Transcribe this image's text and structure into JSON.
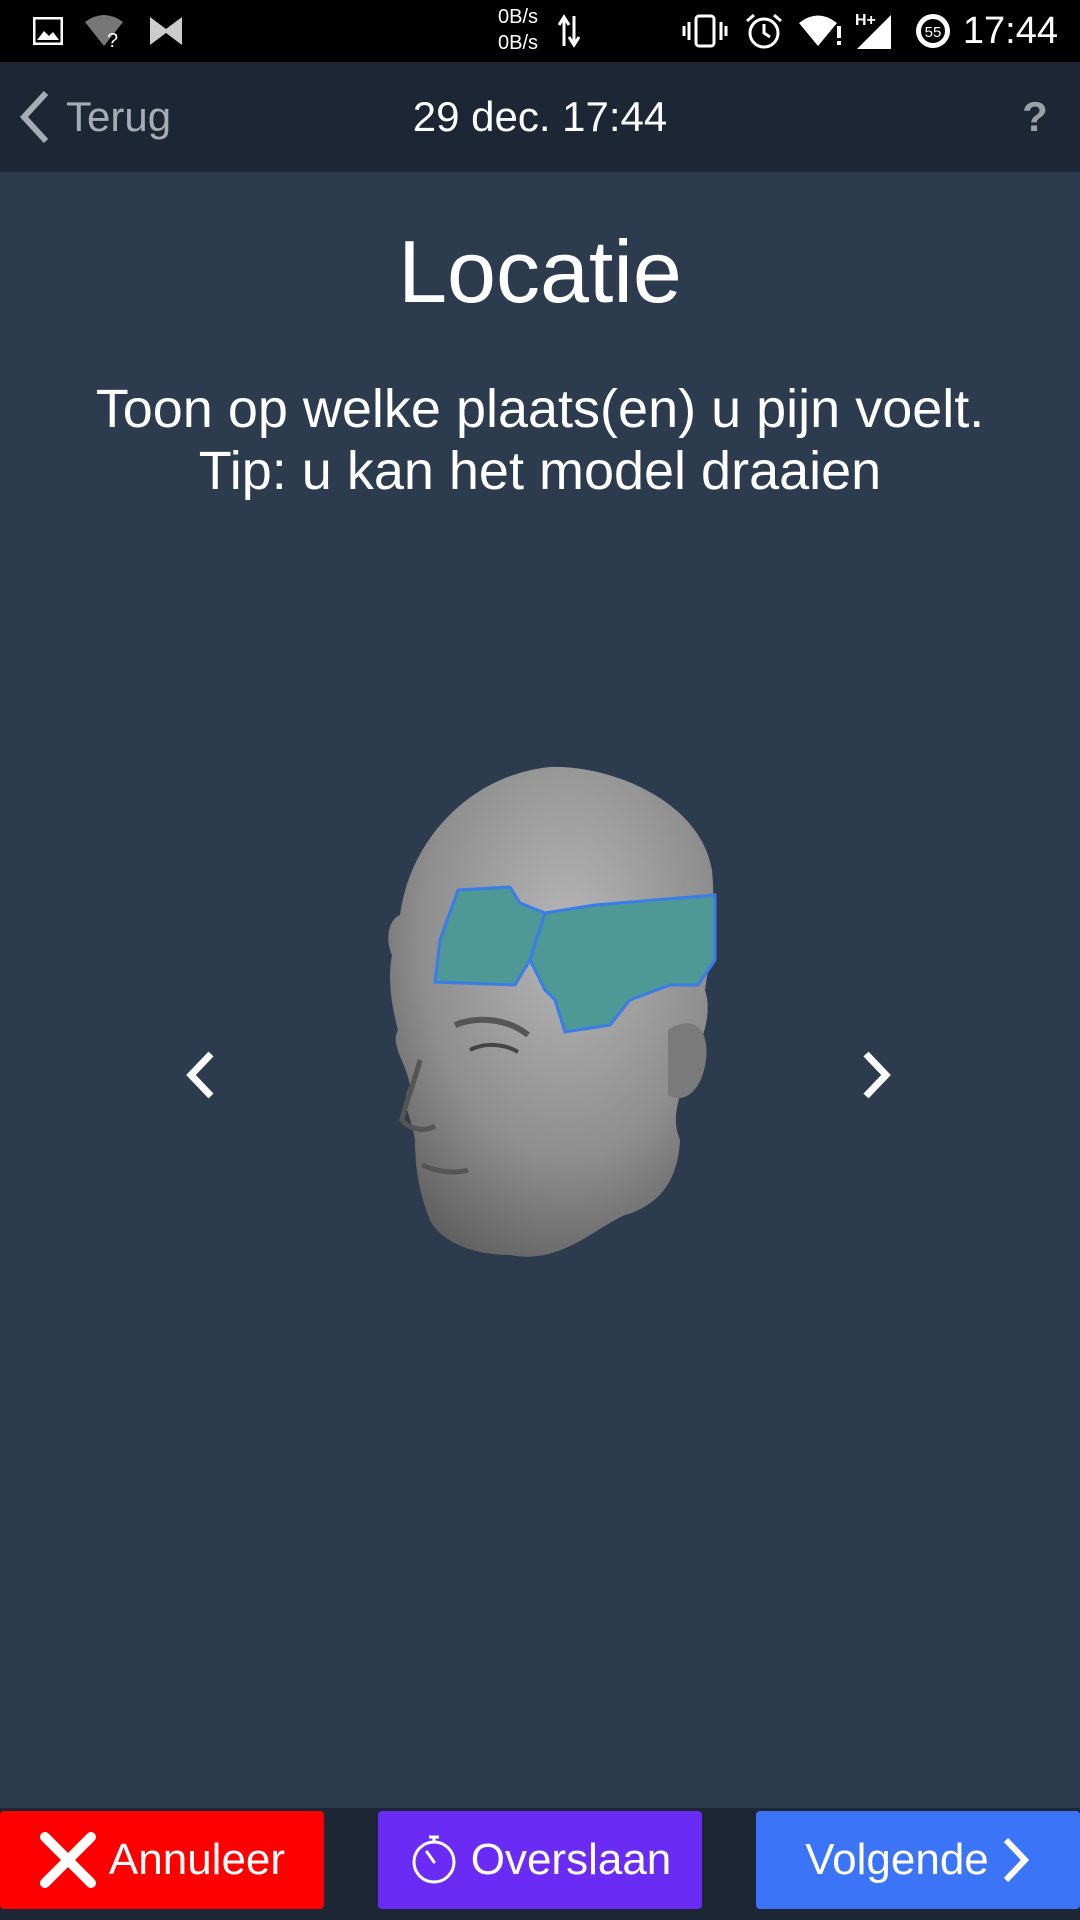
{
  "statusbar": {
    "time": "17:44",
    "net_up": "0B/s",
    "net_down": "0B/s",
    "battery": "55",
    "icons": [
      "image-icon",
      "wifi-question-icon",
      "bowtie-icon",
      "data-arrows-icon",
      "vibrate-icon",
      "alarm-icon",
      "wifi-icon",
      "signal-icon",
      "battery-icon"
    ]
  },
  "nav": {
    "back_label": "Terug",
    "title": "29 dec. 17:44",
    "help_label": "?"
  },
  "main": {
    "title": "Locatie",
    "subtitle_line1": "Toon op welke plaats(en) u pijn voelt.",
    "subtitle_line2": "Tip: u kan het model draaien"
  },
  "footer": {
    "cancel_label": "Annuleer",
    "skip_label": "Overslaan",
    "next_label": "Volgende"
  },
  "colors": {
    "background": "#2d3b4e",
    "bar": "#1d2634",
    "cancel": "#ff0000",
    "skip": "#6a2cf5",
    "next": "#3c74f7",
    "highlight": "#4e9896"
  }
}
